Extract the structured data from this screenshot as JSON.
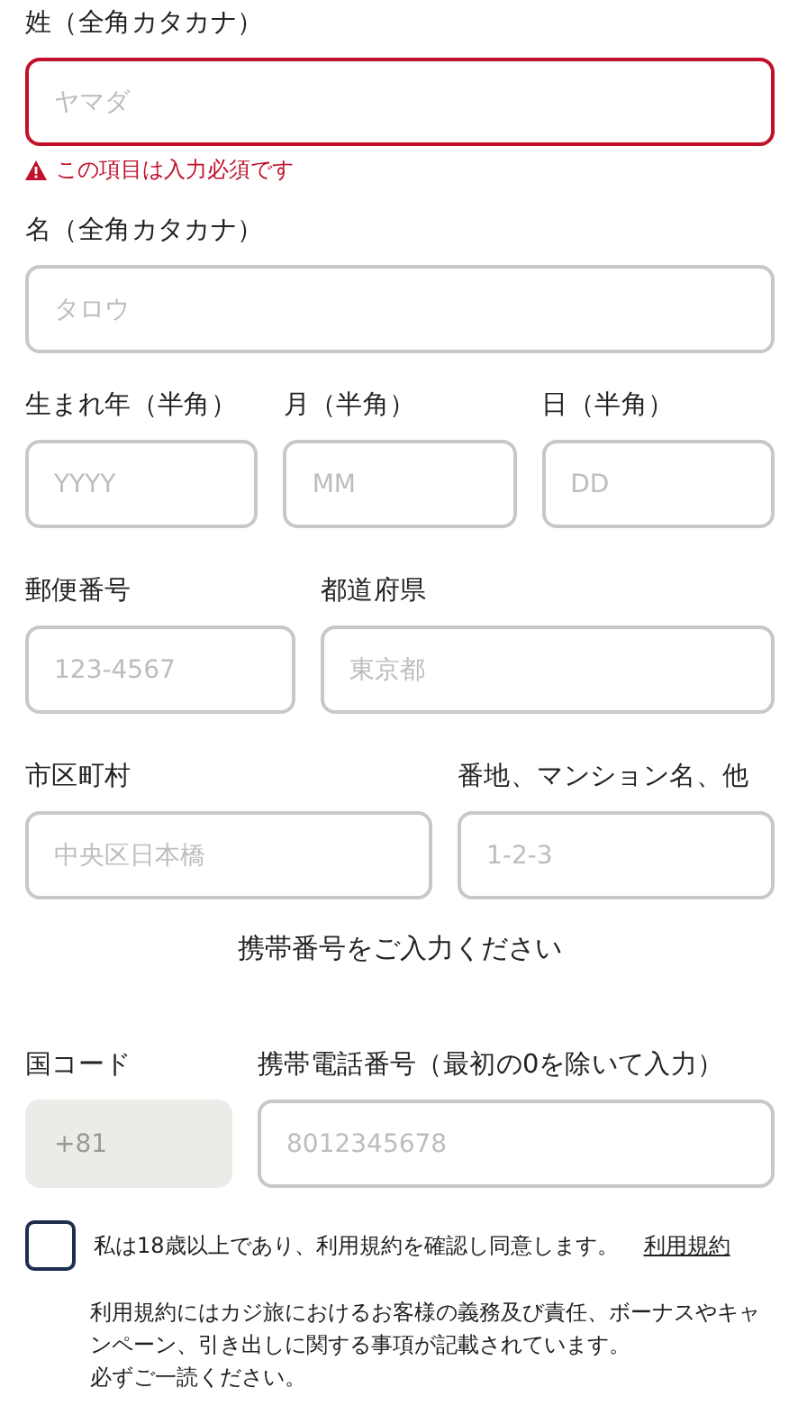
{
  "rows": [
    {
      "kind": "single",
      "fields": [
        {
          "label": "姓（全角カタカナ）",
          "placeholder": "ヤマダ",
          "error": "この項目は入力必須です"
        }
      ]
    },
    {
      "kind": "single",
      "fields": [
        {
          "label": "名（全角カタカナ）",
          "placeholder": "タロウ"
        }
      ]
    },
    {
      "kind": "birth",
      "fields": [
        {
          "label": "生まれ年（半角）",
          "placeholder": "YYYY"
        },
        {
          "label": "月（半角）",
          "placeholder": "MM"
        },
        {
          "label": "日（半角）",
          "placeholder": "DD"
        }
      ]
    },
    {
      "kind": "postal",
      "fields": [
        {
          "label": "郵便番号",
          "placeholder": "123-4567"
        },
        {
          "label": "都道府県",
          "placeholder": "東京都"
        }
      ]
    },
    {
      "kind": "address",
      "fields": [
        {
          "label": "市区町村",
          "placeholder": "中央区日本橋"
        },
        {
          "label": "番地、マンション名、他",
          "placeholder": "1-2-3"
        }
      ]
    },
    {
      "kind": "heading",
      "text": "携帯番号をご入力ください"
    },
    {
      "kind": "phone",
      "fields": [
        {
          "label": "国コード",
          "value": "+81",
          "disabled": true
        },
        {
          "label": "携帯電話番号（最初の0を除いて入力）",
          "placeholder": "8012345678"
        }
      ]
    }
  ],
  "agreement": {
    "checked": false,
    "text": "私は18歳以上であり、利用規約を確認し同意します。",
    "link": "利用規約",
    "note": "利用規約にはカジ旅におけるお客様の義務及び責任、ボーナスやキャンペーン、引き出しに関する事項が記載されています。",
    "note_2": "必ずご一読ください。"
  }
}
